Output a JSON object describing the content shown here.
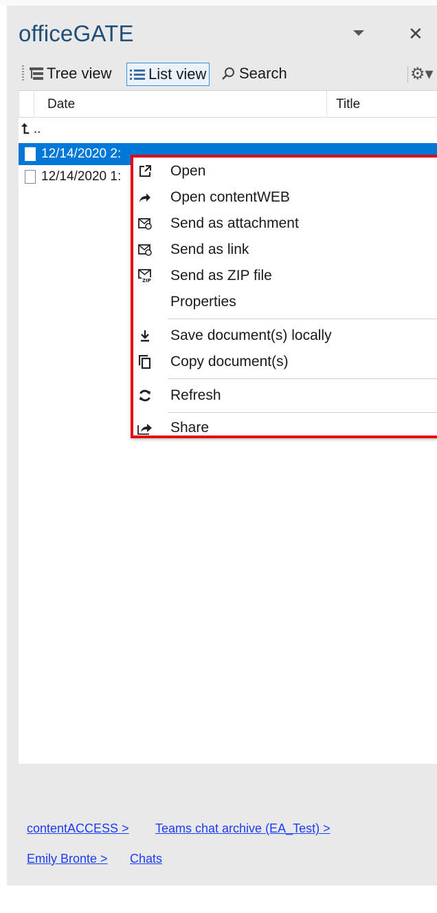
{
  "panel": {
    "title": "officeGATE"
  },
  "toolbar": {
    "tree_view": "Tree view",
    "list_view": "List view",
    "search": "Search"
  },
  "columns": {
    "date": "Date",
    "title": "Title"
  },
  "list": {
    "up": "..",
    "rows": [
      {
        "date": "12/14/2020 2:",
        "title": "",
        "selected": true
      },
      {
        "date": "12/14/2020 1:",
        "title": "",
        "selected": false
      }
    ]
  },
  "context_menu": {
    "items": [
      {
        "label": "Open",
        "icon": "open-external-icon"
      },
      {
        "label": "Open contentWEB",
        "icon": "forward-arrow-icon"
      },
      {
        "label": "Send as attachment",
        "icon": "mail-attachment-icon"
      },
      {
        "label": "Send as link",
        "icon": "mail-link-icon"
      },
      {
        "label": "Send as ZIP file",
        "icon": "mail-zip-icon"
      },
      {
        "label": "Properties",
        "icon": ""
      },
      {
        "label": "Save document(s) locally",
        "icon": "download-icon"
      },
      {
        "label": "Copy document(s)",
        "icon": "copy-icon"
      },
      {
        "label": "Refresh",
        "icon": "refresh-icon"
      },
      {
        "label": "Share",
        "icon": "share-icon"
      }
    ]
  },
  "breadcrumb": {
    "items": [
      "contentACCESS >",
      "Teams chat archive (EA_Test) >",
      "Emily Bronte >",
      "Chats"
    ]
  },
  "colors": {
    "title": "#1f4e79",
    "selection": "#0078d7",
    "highlight_border": "#e8000f",
    "link": "#1a3cff"
  }
}
